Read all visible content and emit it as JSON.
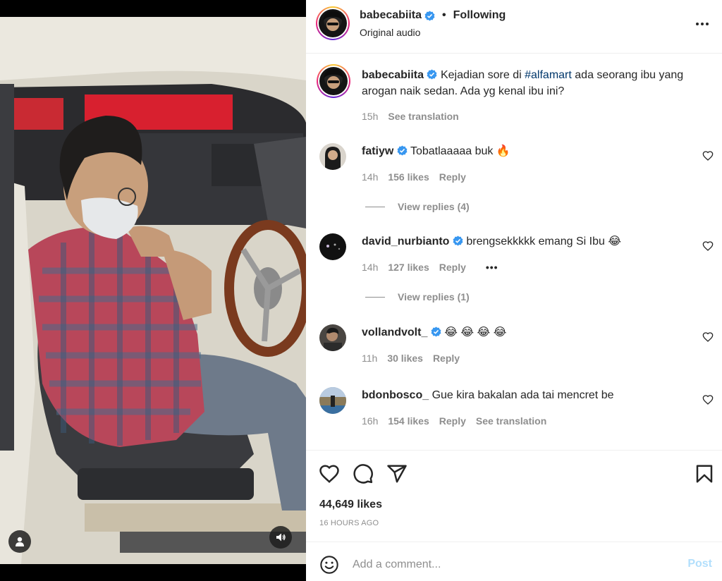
{
  "post": {
    "username": "babecabiita",
    "verified": true,
    "follow_status": "Following",
    "dot": "•",
    "audio": "Original audio",
    "caption_user": "babecabiita",
    "caption_before": "Kejadian sore di ",
    "caption_hashtag": "#alfamart",
    "caption_after": " ada seorang ibu yang arogan naik sedan. Ada yg kenal ibu ini?",
    "caption_time": "15h",
    "caption_translation": "See translation",
    "likes": "44,649 likes",
    "time_ago": "16 HOURS AGO"
  },
  "comments": [
    {
      "username": "fatiyw",
      "verified": true,
      "text": "Tobatlaaaaa buk 🔥",
      "time": "14h",
      "likes": "156 likes",
      "reply": "Reply",
      "view_replies": "View replies (4)"
    },
    {
      "username": "david_nurbianto",
      "verified": true,
      "text": "brengsekkkkk emang Si Ibu 😂",
      "time": "14h",
      "likes": "127 likes",
      "reply": "Reply",
      "view_replies": "View replies (1)"
    },
    {
      "username": "vollandvolt_",
      "verified": true,
      "text": "😂 😂 😂 😂",
      "time": "11h",
      "likes": "30 likes",
      "reply": "Reply"
    },
    {
      "username": "bdonbosco_",
      "verified": false,
      "text": "Gue kira bakalan ada tai mencret be",
      "time": "16h",
      "likes": "154 likes",
      "reply": "Reply",
      "translation": "See translation"
    }
  ],
  "composer": {
    "placeholder": "Add a comment...",
    "post_label": "Post"
  },
  "icons": {
    "more": "more-options-icon",
    "like": "heart-icon",
    "comment": "comment-icon",
    "share": "share-icon",
    "save": "bookmark-icon",
    "emoji": "emoji-icon",
    "tag": "user-tag-icon",
    "audio": "speaker-icon"
  },
  "colors": {
    "verified": "#3897f0",
    "link": "#00376b",
    "post_disabled": "#b2dffc",
    "muted_text": "#8e8e8e"
  }
}
